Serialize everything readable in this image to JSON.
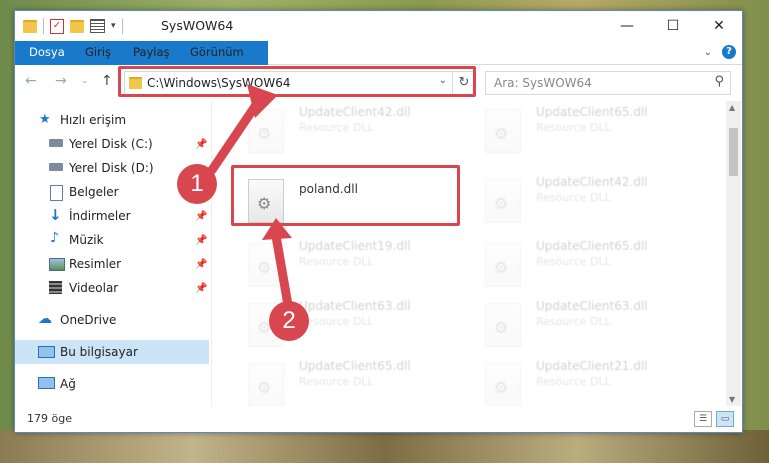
{
  "window": {
    "title": "SysWOW64"
  },
  "ribbon": {
    "tabs": [
      "Dosya",
      "Giriş",
      "Paylaş",
      "Görünüm"
    ]
  },
  "address": {
    "path": "C:\\Windows\\SysWOW64",
    "search_placeholder": "Ara: SysWOW64"
  },
  "sidebar": {
    "quick_access": "Hızlı erişim",
    "items": [
      {
        "label": "Yerel Disk (C:)",
        "pinned": true
      },
      {
        "label": "Yerel Disk (D:)",
        "pinned": false
      },
      {
        "label": "Belgeler",
        "pinned": true
      },
      {
        "label": "İndirmeler",
        "pinned": true
      },
      {
        "label": "Müzik",
        "pinned": true
      },
      {
        "label": "Resimler",
        "pinned": true
      },
      {
        "label": "Videolar",
        "pinned": true
      }
    ],
    "onedrive": "OneDrive",
    "this_pc": "Bu bilgisayar",
    "network": "Ağ"
  },
  "files": {
    "left_column": [
      {
        "name": "UpdateClient42.dll",
        "type": "Resource DLL"
      },
      {
        "name": "poland.dll",
        "type": ""
      },
      {
        "name": "UpdateClient19.dll",
        "type": "Resource DLL"
      },
      {
        "name": "UpdateClient63.dll",
        "type": "Resource DLL"
      },
      {
        "name": "UpdateClient65.dll",
        "type": "Resource DLL"
      }
    ],
    "right_column": [
      {
        "name": "UpdateClient65.dll",
        "type": "Resource DLL"
      },
      {
        "name": "UpdateClient42.dll",
        "type": "Resource DLL"
      },
      {
        "name": "UpdateClient65.dll",
        "type": "Resource DLL"
      },
      {
        "name": "UpdateClient63.dll",
        "type": "Resource DLL"
      },
      {
        "name": "UpdateClient21.dll",
        "type": "Resource DLL"
      }
    ]
  },
  "status": {
    "item_count": "179 öge"
  },
  "callouts": [
    "1",
    "2"
  ],
  "colors": {
    "accent": "#1979ca",
    "highlight": "#d8474f",
    "selection": "#cce4f7"
  }
}
